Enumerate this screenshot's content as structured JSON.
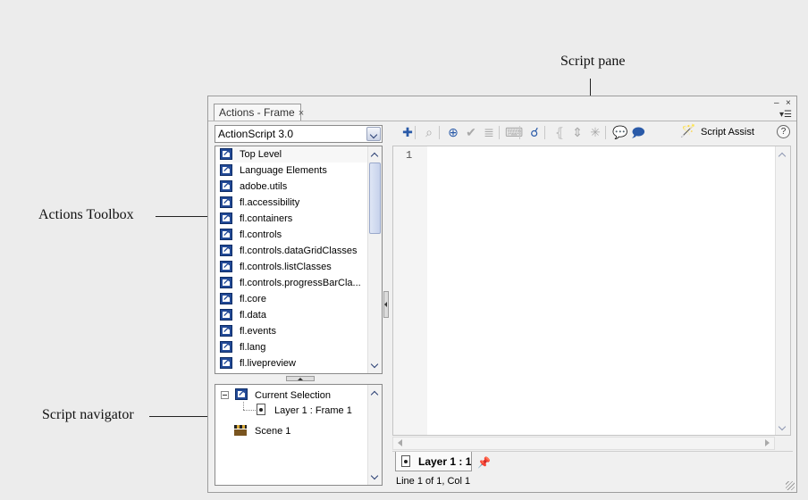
{
  "callouts": {
    "script_pane": "Script pane",
    "actions_toolbox": "Actions Toolbox",
    "script_navigator": "Script navigator"
  },
  "panel": {
    "tab_title": "Actions - Frame",
    "tab_close": "×",
    "minimize_glyph": "–",
    "close_glyph": "×",
    "menu_glyph": "▾☰"
  },
  "toolbox": {
    "version_selected": "ActionScript 3.0",
    "items": [
      "Top Level",
      "Language Elements",
      "adobe.utils",
      "fl.accessibility",
      "fl.containers",
      "fl.controls",
      "fl.controls.dataGridClasses",
      "fl.controls.listClasses",
      "fl.controls.progressBarCla...",
      "fl.core",
      "fl.data",
      "fl.events",
      "fl.lang",
      "fl.livepreview"
    ]
  },
  "navigator": {
    "current_selection": "Current Selection",
    "layer_frame": "Layer 1 : Frame 1",
    "scene": "Scene 1"
  },
  "toolbar": {
    "buttons": [
      {
        "name": "add-statement-icon",
        "glyph": "✚",
        "enabled": true
      },
      {
        "name": "find-icon",
        "glyph": "⌕",
        "enabled": false
      },
      {
        "name": "insert-target-path-icon",
        "glyph": "⊕",
        "enabled": true
      },
      {
        "name": "check-syntax-icon",
        "glyph": "✔",
        "enabled": false
      },
      {
        "name": "auto-format-icon",
        "glyph": "≣",
        "enabled": false
      },
      {
        "name": "show-code-hint-icon",
        "glyph": "⌨",
        "enabled": false
      },
      {
        "name": "debug-options-icon",
        "glyph": "☌",
        "enabled": true
      },
      {
        "name": "collapse-between-braces-icon",
        "glyph": "⦃",
        "enabled": false
      },
      {
        "name": "collapse-selection-icon",
        "glyph": "⇕",
        "enabled": false
      },
      {
        "name": "expand-all-icon",
        "glyph": "✳",
        "enabled": false
      },
      {
        "name": "apply-block-comment-icon",
        "glyph": "💬",
        "enabled": true
      },
      {
        "name": "apply-line-comment-icon",
        "glyph": "🗩",
        "enabled": true
      }
    ],
    "script_assist": "Script Assist",
    "help": "?"
  },
  "editor": {
    "line_number": "1"
  },
  "script_tab": {
    "label": "Layer 1 : 1"
  },
  "status": {
    "text": "Line 1 of 1, Col 1"
  }
}
